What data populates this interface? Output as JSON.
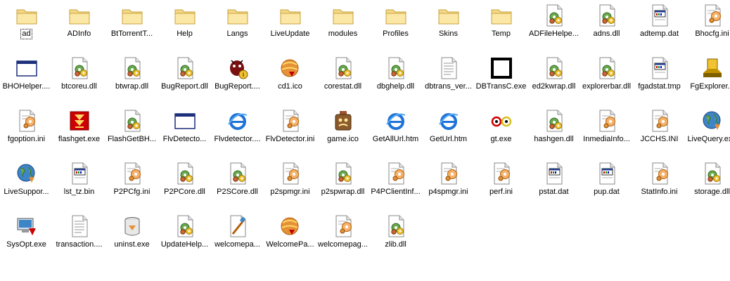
{
  "focused_index": 0,
  "items": [
    {
      "label": "ad",
      "icon": "folder-icon",
      "kind": "folder"
    },
    {
      "label": "ADInfo",
      "icon": "folder-icon",
      "kind": "folder"
    },
    {
      "label": "BtTorrentT...",
      "icon": "folder-icon",
      "kind": "folder"
    },
    {
      "label": "Help",
      "icon": "folder-icon",
      "kind": "folder"
    },
    {
      "label": "Langs",
      "icon": "folder-icon",
      "kind": "folder"
    },
    {
      "label": "LiveUpdate",
      "icon": "folder-icon",
      "kind": "folder"
    },
    {
      "label": "modules",
      "icon": "folder-icon",
      "kind": "folder"
    },
    {
      "label": "Profiles",
      "icon": "folder-icon",
      "kind": "folder"
    },
    {
      "label": "Skins",
      "icon": "folder-icon",
      "kind": "folder"
    },
    {
      "label": "Temp",
      "icon": "folder-icon",
      "kind": "folder"
    },
    {
      "label": "ADFileHelpe...",
      "icon": "dll-file-icon",
      "kind": "dll"
    },
    {
      "label": "adns.dll",
      "icon": "dll-file-icon",
      "kind": "dll"
    },
    {
      "label": "adtemp.dat",
      "icon": "dat-file-icon",
      "kind": "dat"
    },
    {
      "label": "Bhocfg.ini",
      "icon": "ini-file-icon",
      "kind": "ini"
    },
    {
      "label": "BHOHelper....",
      "icon": "exe-window-icon",
      "kind": "window"
    },
    {
      "label": "btcoreu.dll",
      "icon": "dll-file-icon",
      "kind": "dll"
    },
    {
      "label": "btwrap.dll",
      "icon": "dll-file-icon",
      "kind": "dll"
    },
    {
      "label": "BugReport.dll",
      "icon": "dll-file-icon",
      "kind": "dll"
    },
    {
      "label": "BugReport....",
      "icon": "bug-report-icon",
      "kind": "bug"
    },
    {
      "label": "cd1.ico",
      "icon": "flashget-globe-icon",
      "kind": "fglobe"
    },
    {
      "label": "corestat.dll",
      "icon": "dll-file-icon",
      "kind": "dll"
    },
    {
      "label": "dbghelp.dll",
      "icon": "dll-file-icon",
      "kind": "dll"
    },
    {
      "label": "dbtrans_ver...",
      "icon": "text-file-icon",
      "kind": "txt"
    },
    {
      "label": "DBTransC.exe",
      "icon": "black-square-icon",
      "kind": "blacksq"
    },
    {
      "label": "ed2kwrap.dll",
      "icon": "dll-file-icon",
      "kind": "dll"
    },
    {
      "label": "explorerbar.dll",
      "icon": "dll-file-icon",
      "kind": "dll"
    },
    {
      "label": "fgadstat.tmp",
      "icon": "dat-file-icon",
      "kind": "dat"
    },
    {
      "label": "FgExplorer...",
      "icon": "fgexplorer-icon",
      "kind": "fgexp"
    },
    {
      "label": "fgoption.ini",
      "icon": "ini-file-icon",
      "kind": "ini"
    },
    {
      "label": "flashget.exe",
      "icon": "flashget-logo-icon",
      "kind": "fglogo"
    },
    {
      "label": "FlashGetBH...",
      "icon": "dll-file-icon",
      "kind": "dll"
    },
    {
      "label": "FlvDetecto...",
      "icon": "exe-window-icon",
      "kind": "window"
    },
    {
      "label": "Flvdetector....",
      "icon": "ie-browser-icon",
      "kind": "ie"
    },
    {
      "label": "FlvDetector.ini",
      "icon": "ini-file-icon",
      "kind": "ini"
    },
    {
      "label": "game.ico",
      "icon": "game-icon",
      "kind": "game"
    },
    {
      "label": "GetAllUrl.htm",
      "icon": "ie-browser-icon",
      "kind": "ie"
    },
    {
      "label": "GetUrl.htm",
      "icon": "ie-browser-icon",
      "kind": "ie"
    },
    {
      "label": "gt.exe",
      "icon": "gt-eyes-icon",
      "kind": "eyes"
    },
    {
      "label": "hashgen.dll",
      "icon": "dll-file-icon",
      "kind": "dll"
    },
    {
      "label": "InmediaInfo...",
      "icon": "ini-file-icon",
      "kind": "ini"
    },
    {
      "label": "JCCHS.INI",
      "icon": "ini-file-icon",
      "kind": "ini"
    },
    {
      "label": "LiveQuery.exe",
      "icon": "live-globe-icon",
      "kind": "lglobe"
    },
    {
      "label": "LiveSuppor...",
      "icon": "live-globe-icon",
      "kind": "lglobe"
    },
    {
      "label": "lst_tz.bin",
      "icon": "dat-file-icon",
      "kind": "dat"
    },
    {
      "label": "P2PCfg.ini",
      "icon": "ini-file-icon",
      "kind": "ini"
    },
    {
      "label": "P2PCore.dll",
      "icon": "dll-file-icon",
      "kind": "dll"
    },
    {
      "label": "P2SCore.dll",
      "icon": "dll-file-icon",
      "kind": "dll"
    },
    {
      "label": "p2spmgr.ini",
      "icon": "ini-file-icon",
      "kind": "ini"
    },
    {
      "label": "p2spwrap.dll",
      "icon": "dll-file-icon",
      "kind": "dll"
    },
    {
      "label": "P4PClientInf...",
      "icon": "ini-file-icon",
      "kind": "ini"
    },
    {
      "label": "p4spmgr.ini",
      "icon": "ini-file-icon",
      "kind": "ini"
    },
    {
      "label": "perf.ini",
      "icon": "ini-file-icon",
      "kind": "ini"
    },
    {
      "label": "pstat.dat",
      "icon": "dat-file-icon",
      "kind": "dat"
    },
    {
      "label": "pup.dat",
      "icon": "dat-file-icon",
      "kind": "dat"
    },
    {
      "label": "StatInfo.ini",
      "icon": "ini-file-icon",
      "kind": "ini"
    },
    {
      "label": "storage.dll",
      "icon": "dll-file-icon",
      "kind": "dll"
    },
    {
      "label": "SysOpt.exe",
      "icon": "sysopt-icon",
      "kind": "sysopt"
    },
    {
      "label": "transaction....",
      "icon": "text-file-icon",
      "kind": "txt"
    },
    {
      "label": "uninst.exe",
      "icon": "uninstall-icon",
      "kind": "uninst"
    },
    {
      "label": "UpdateHelp...",
      "icon": "dll-file-icon",
      "kind": "dll"
    },
    {
      "label": "welcomepa...",
      "icon": "welcome-brush-icon",
      "kind": "brush"
    },
    {
      "label": "WelcomePa...",
      "icon": "flashget-globe-icon",
      "kind": "fglobe"
    },
    {
      "label": "welcomepag...",
      "icon": "ini-file-icon",
      "kind": "ini"
    },
    {
      "label": "zlib.dll",
      "icon": "dll-file-icon",
      "kind": "dll"
    }
  ]
}
